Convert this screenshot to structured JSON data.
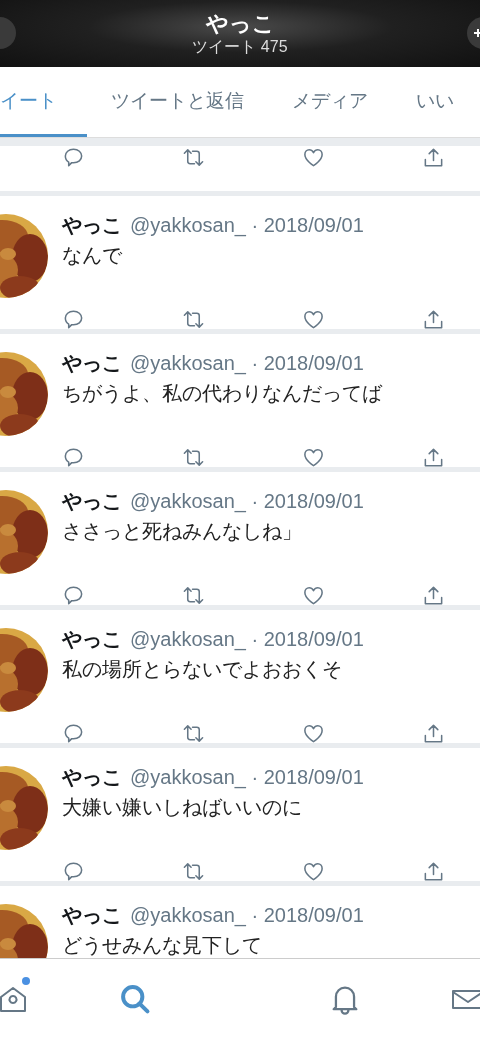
{
  "header": {
    "title": "やっこ",
    "subtitle": "ツイート 475"
  },
  "tabs": [
    {
      "label": "イート",
      "selected": true
    },
    {
      "label": "ツイートと返信",
      "selected": false
    },
    {
      "label": "メディア",
      "selected": false
    },
    {
      "label": "いい",
      "selected": false
    }
  ],
  "tweets": [
    {
      "kind": "actions_only"
    },
    {
      "kind": "tweet",
      "name": "やっこ",
      "meta": "@yakkosan_ · 2018/09/01",
      "text": "なんで"
    },
    {
      "kind": "tweet",
      "name": "やっこ",
      "meta": "@yakkosan_ · 2018/09/01",
      "text": "ちがうよ、私の代わりなんだってば"
    },
    {
      "kind": "tweet",
      "name": "やっこ",
      "meta": "@yakkosan_ · 2018/09/01",
      "text": "ささっと死ねみんなしね」"
    },
    {
      "kind": "tweet",
      "name": "やっこ",
      "meta": "@yakkosan_ · 2018/09/01",
      "text": "私の場所とらないでよおおくそ"
    },
    {
      "kind": "tweet",
      "name": "やっこ",
      "meta": "@yakkosan_ · 2018/09/01",
      "text": "大嫌い嫌いしねばいいのに"
    },
    {
      "kind": "tweet_cut",
      "name": "やっこ",
      "meta": "@yakkosan_ · 2018/09/01",
      "text": "どうせみんな見下して"
    }
  ],
  "nav": [
    {
      "kind": "home",
      "selected": false,
      "badge": true
    },
    {
      "kind": "search",
      "selected": true,
      "badge": false
    },
    {
      "kind": "notifications",
      "selected": false,
      "badge": false
    },
    {
      "kind": "messages",
      "selected": false,
      "badge": false
    }
  ]
}
